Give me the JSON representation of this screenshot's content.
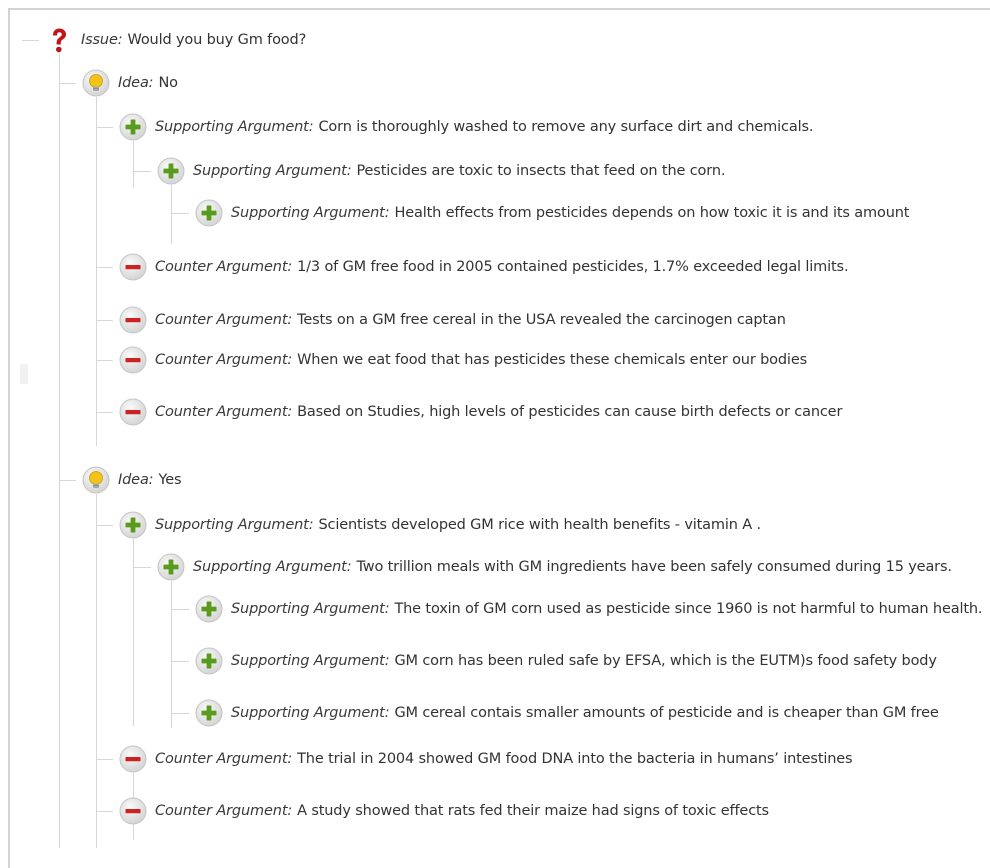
{
  "tree": {
    "nodes": [
      {
        "type": "issue",
        "label": "Issue:",
        "text": "Would you buy Gm food?"
      },
      {
        "type": "idea",
        "label": "Idea:",
        "text": "No"
      },
      {
        "type": "support",
        "label": "Supporting Argument:",
        "text": "Corn is thoroughly washed to remove any surface dirt and chemicals."
      },
      {
        "type": "support",
        "label": "Supporting Argument:",
        "text": "Pesticides are toxic to insects that feed on the corn."
      },
      {
        "type": "support",
        "label": "Supporting Argument:",
        "text": "Health effects from pesticides depends on how toxic it is and its amount"
      },
      {
        "type": "counter",
        "label": "Counter Argument:",
        "text": "1/3 of GM free food in 2005 contained pesticides, 1.7% exceeded legal limits."
      },
      {
        "type": "counter",
        "label": "Counter Argument:",
        "text": "Tests on a GM free cereal in the USA revealed the carcinogen captan"
      },
      {
        "type": "counter",
        "label": "Counter Argument:",
        "text": "When we eat food that has pesticides these chemicals enter our bodies"
      },
      {
        "type": "counter",
        "label": "Counter Argument:",
        "text": "Based on Studies, high levels of pesticides can cause birth defects or cancer"
      },
      {
        "type": "idea",
        "label": "Idea:",
        "text": "Yes"
      },
      {
        "type": "support",
        "label": "Supporting Argument:",
        "text": "Scientists developed GM rice with health benefits - vitamin A ."
      },
      {
        "type": "support",
        "label": "Supporting Argument:",
        "text": "Two trillion meals with GM ingredients have been safely consumed during 15 years."
      },
      {
        "type": "support",
        "label": "Supporting Argument:",
        "text": "The toxin of GM corn used as pesticide since 1960 is not harmful to human health."
      },
      {
        "type": "support",
        "label": "Supporting Argument:",
        "text": "GM corn has been ruled safe by EFSA, which is the EUTM)s food safety body"
      },
      {
        "type": "support",
        "label": "Supporting Argument:",
        "text": "GM cereal contais smaller amounts of pesticide and is cheaper than GM free"
      },
      {
        "type": "counter",
        "label": "Counter Argument:",
        "text": "The trial in 2004 showed GM food DNA into the bacteria in humans’ intestines"
      },
      {
        "type": "counter",
        "label": "Counter Argument:",
        "text": "A study showed that rats fed their maize had signs of toxic effects"
      }
    ]
  },
  "icon_names": {
    "issue": "question-mark-icon",
    "idea": "lightbulb-icon",
    "support": "plus-icon",
    "counter": "minus-icon"
  },
  "colors": {
    "issue_icon": "#c0141b",
    "idea_icon": "#f2c318",
    "support_icon": "#5a9a1c",
    "counter_icon": "#cc2222",
    "connector_line": "#d6d6d6"
  }
}
